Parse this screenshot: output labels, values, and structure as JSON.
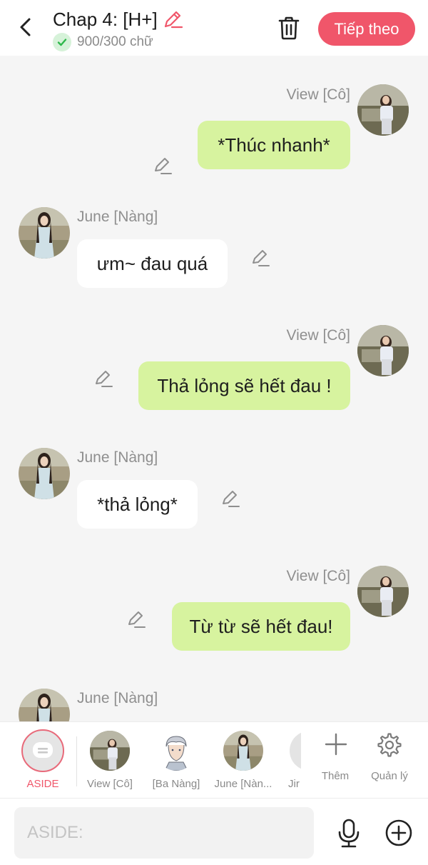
{
  "header": {
    "title": "Chap 4: [H+]",
    "word_count": "900/300 chữ",
    "next_label": "Tiếp theo",
    "accent_color": "#f0566a"
  },
  "messages": [
    {
      "side": "out",
      "sender": "View [Cô]",
      "text": "*Thúc nhanh*"
    },
    {
      "side": "in",
      "sender": "June [Nàng]",
      "text": "ưm~ đau quá"
    },
    {
      "side": "out",
      "sender": "View [Cô]",
      "text": "Thả lỏng sẽ hết đau !"
    },
    {
      "side": "in",
      "sender": "June [Nàng]",
      "text": "*thả lỏng*"
    },
    {
      "side": "out",
      "sender": "View [Cô]",
      "text": "Từ từ sẽ hết đau!"
    },
    {
      "side": "in",
      "sender": "June [Nàng]",
      "text": ""
    }
  ],
  "characters": {
    "aside": "ASIDE",
    "view": "View [Cô]",
    "ba_nang": "[Ba Nàng]",
    "june": "June [Nàn...",
    "jin": "Jir",
    "add": "Thêm",
    "manage": "Quản lý"
  },
  "composer": {
    "placeholder": "ASIDE:"
  },
  "colors": {
    "outgoing_bubble": "#d7f39f",
    "incoming_bubble": "#ffffff",
    "background": "#f5f5f5"
  }
}
